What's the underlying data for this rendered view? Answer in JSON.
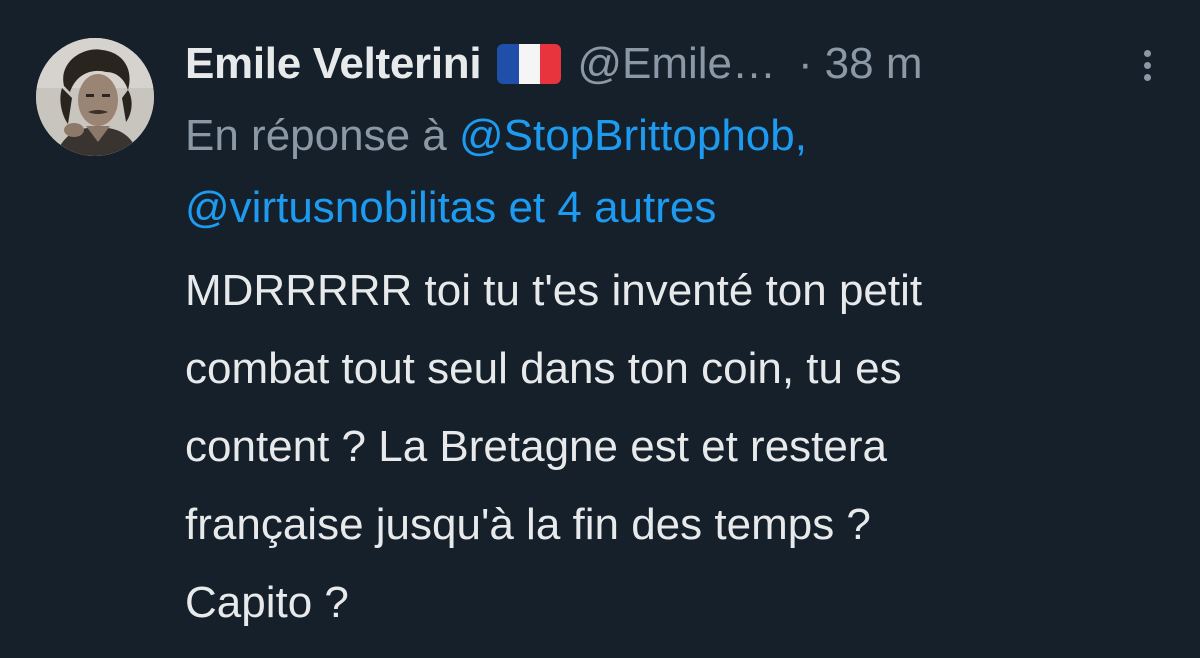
{
  "tweet": {
    "author": {
      "display_name": "Emile Velterini",
      "flag_emoji": "French flag",
      "handle": "@Emile…",
      "separator": "·",
      "time": "38 m",
      "avatar_icon": "person-avatar"
    },
    "reply": {
      "prefix": "En réponse à",
      "mention_1": "@StopBrittophob,",
      "mention_2": "@virtusnobilitas et 4 autres"
    },
    "body_lines": [
      "MDRRRRR toi tu t'es inventé ton petit",
      "combat tout seul dans ton coin, tu es",
      "content ? La Bretagne est et restera",
      "française jusqu'à la fin des temps ?",
      "Capito ?"
    ],
    "more_icon": "more-vertical-icon"
  },
  "colors": {
    "background": "#15202b",
    "text_primary": "#e7e9ea",
    "text_secondary": "#8b98a5",
    "link": "#1d9bf0"
  }
}
